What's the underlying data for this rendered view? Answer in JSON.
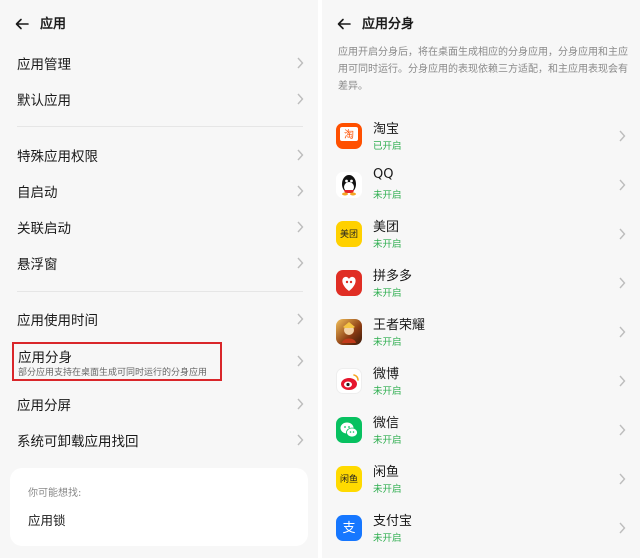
{
  "left": {
    "title": "应用",
    "rows": [
      {
        "label": "应用管理"
      },
      {
        "label": "默认应用"
      },
      {
        "label": "特殊应用权限"
      },
      {
        "label": "自启动"
      },
      {
        "label": "关联启动"
      },
      {
        "label": "悬浮窗"
      },
      {
        "label": "应用使用时间"
      }
    ],
    "highlighted": {
      "label": "应用分身",
      "sub": "部分应用支持在桌面生成可同时运行的分身应用"
    },
    "rows_after": [
      {
        "label": "应用分屏"
      },
      {
        "label": "系统可卸载应用找回"
      }
    ],
    "suggest": {
      "hint": "你可能想找:",
      "item": "应用锁"
    }
  },
  "right": {
    "title": "应用分身",
    "description": "应用开启分身后，将在桌面生成相应的分身应用，分身应用和主应用可同时运行。分身应用的表现依赖三方适配，和主应用表现会有差异。",
    "apps": [
      {
        "name": "淘宝",
        "status": "已开启",
        "icon": "taobao-icon",
        "color": "#ff5000"
      },
      {
        "name": "QQ",
        "status": "未开启",
        "icon": "qq-icon",
        "color": "#111111"
      },
      {
        "name": "美团",
        "status": "未开启",
        "icon": "meituan-icon",
        "color": "#ffd100"
      },
      {
        "name": "拼多多",
        "status": "未开启",
        "icon": "pinduoduo-icon",
        "color": "#e02e24"
      },
      {
        "name": "王者荣耀",
        "status": "未开启",
        "icon": "honor-of-kings-icon",
        "color": "#6b3c1c"
      },
      {
        "name": "微博",
        "status": "未开启",
        "icon": "weibo-icon",
        "color": "#e6162d"
      },
      {
        "name": "微信",
        "status": "未开启",
        "icon": "wechat-icon",
        "color": "#07c160"
      },
      {
        "name": "闲鱼",
        "status": "未开启",
        "icon": "xianyu-icon",
        "color": "#ffda00"
      },
      {
        "name": "支付宝",
        "status": "未开启",
        "icon": "alipay-icon",
        "color": "#1677ff"
      }
    ]
  }
}
